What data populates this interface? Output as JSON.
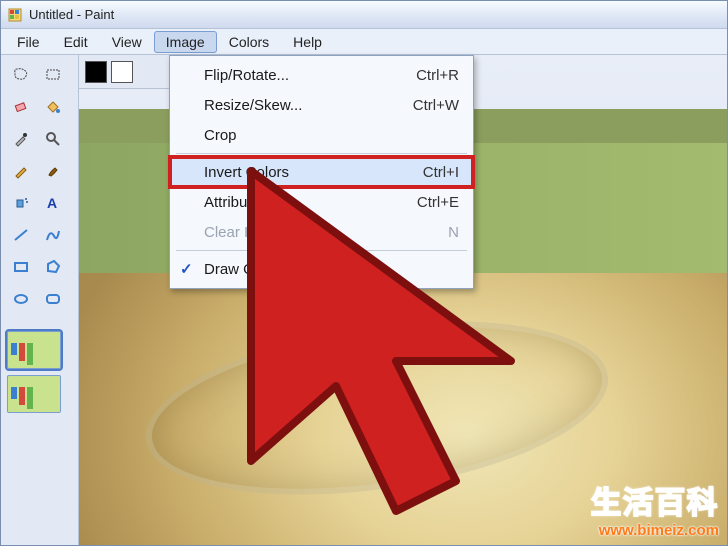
{
  "title": "Untitled - Paint",
  "menus": {
    "file": "File",
    "edit": "Edit",
    "view": "View",
    "image": "Image",
    "colors": "Colors",
    "help": "Help"
  },
  "image_menu": {
    "flip_rotate": {
      "label": "Flip/Rotate...",
      "shortcut": "Ctrl+R"
    },
    "resize_skew": {
      "label": "Resize/Skew...",
      "shortcut": "Ctrl+W"
    },
    "crop": {
      "label": "Crop",
      "shortcut": ""
    },
    "invert_colors": {
      "label": "Invert Colors",
      "shortcut": "Ctrl+I"
    },
    "attributes": {
      "label": "Attributes...",
      "shortcut": "Ctrl+E"
    },
    "clear_image": {
      "label": "Clear Image",
      "shortcut": "N"
    },
    "draw_opaque": {
      "label": "Draw Opaque",
      "shortcut": "",
      "checked": true
    }
  },
  "tools": [
    "free-select",
    "rect-select",
    "eraser",
    "fill",
    "picker",
    "magnifier",
    "pencil",
    "brush",
    "airbrush",
    "text",
    "line",
    "curve",
    "rectangle",
    "polygon",
    "ellipse",
    "rounded-rect"
  ],
  "colors": {
    "fg": "#000000",
    "bg": "#ffffff"
  },
  "watermark": {
    "chinese": "生活百科",
    "url": "www.bimeiz.com"
  }
}
